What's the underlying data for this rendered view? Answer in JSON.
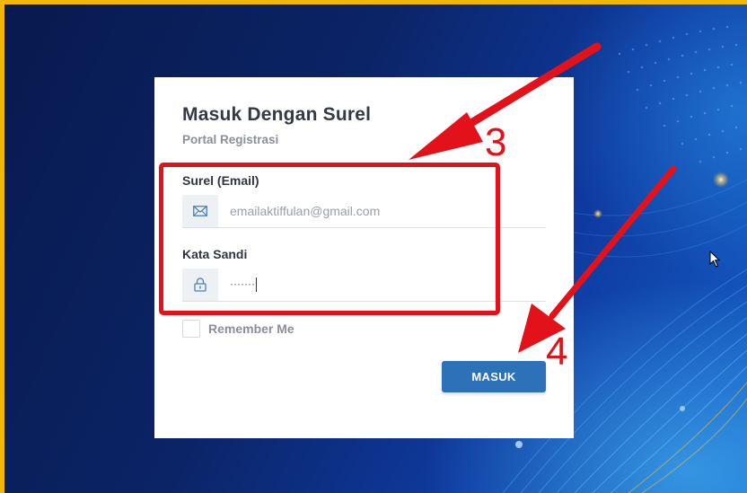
{
  "login": {
    "title": "Masuk Dengan Surel",
    "subtitle": "Portal Registrasi",
    "email_label": "Surel (Email)",
    "email_value": "emailaktiffulan@gmail.com",
    "password_label": "Kata Sandi",
    "password_value": "·······",
    "remember_label": "Remember Me",
    "submit_label": "MASUK"
  },
  "annotations": {
    "step_3": "3",
    "step_4": "4"
  },
  "icons": {
    "email": "envelope-icon",
    "password": "lock-icon",
    "cursor": "mouse-cursor-icon"
  },
  "colors": {
    "accent_button": "#2d72b8",
    "annotation_red": "#e3121a",
    "frame_border": "#f2b705",
    "background_dark": "#0a1f5c"
  }
}
